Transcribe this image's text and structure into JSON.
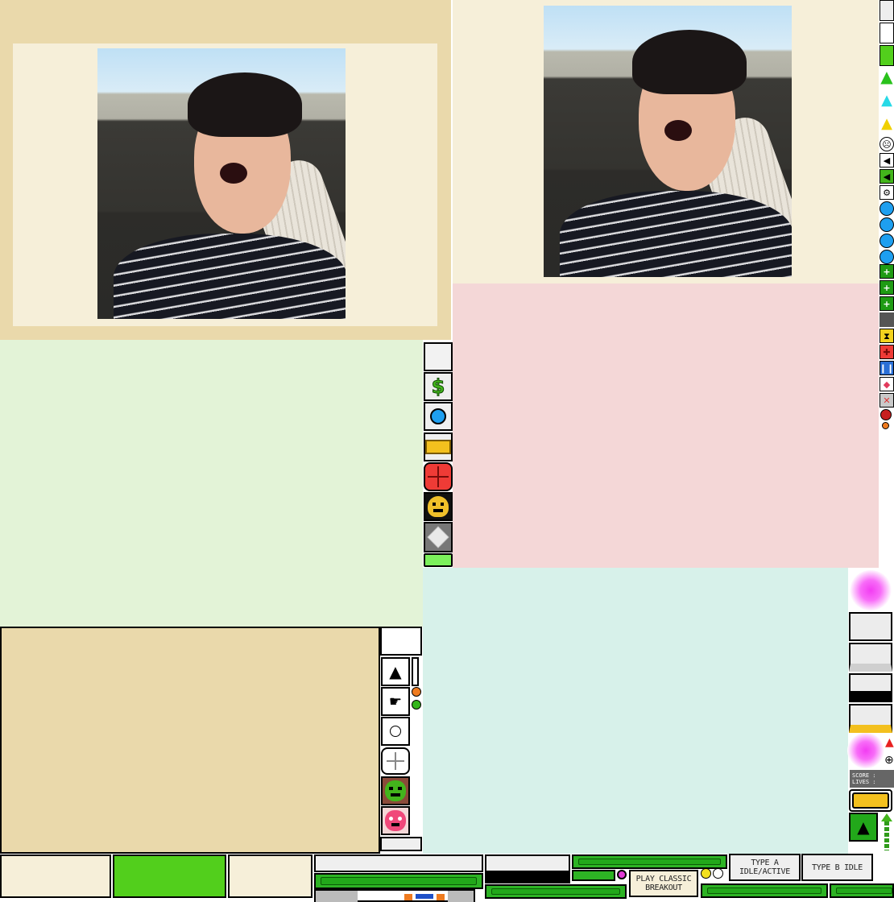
{
  "colors": {
    "panel_tan": "#ead9ab",
    "panel_cream": "#f6efd9",
    "panel_green": "#e3f3d7",
    "panel_pink": "#f4d7d7",
    "panel_mint": "#d7f1ea",
    "accent_green": "#52cf1c",
    "accent_yellow": "#f3c01e",
    "accent_red": "#ef3b36",
    "accent_magenta": "#f23cf2",
    "accent_blue": "#1e9ff0"
  },
  "photos": [
    {
      "name": "player-photo-left",
      "alt": "Photo of a young man yawning"
    },
    {
      "name": "player-photo-right",
      "alt": "Photo of a young man yawning"
    }
  ],
  "icons": {
    "right_column": [
      "blank-button",
      "blank-button",
      "green-button",
      "green-cursor-icon",
      "cyan-cursor-icon",
      "yellow-cursor-icon",
      "skull-icon",
      "speaker-icon",
      "speaker-active-icon",
      "gear-icon",
      "blue-ball-icon",
      "blue-ball-icon",
      "blue-ball-icon",
      "blue-ball-icon",
      "green-cross-icon",
      "green-cross-icon",
      "green-cross-icon",
      "hourglass-icon",
      "red-target-icon",
      "pause-icon",
      "shield-icon",
      "cross-box-icon",
      "red-bomb-icon",
      "orange-dot-icon"
    ],
    "middle_column": [
      "blank-button",
      "dollar-icon",
      "blue-ball-icon",
      "yellow-bar-icon",
      "red-crosshair-icon",
      "yellow-monster-icon",
      "cube-icon",
      "green-bar-icon"
    ],
    "lower_column": [
      "blank-button",
      "chevron-up-icon",
      "hand-pointer-icon",
      "white-ball-icon",
      "crosshair-icon",
      "green-monster-icon",
      "pink-monster-icon",
      "blank-button"
    ]
  },
  "score_label": "SCORE :",
  "lives_label": "LIVES :",
  "buttons": {
    "play_classic": "PLAY CLASSIC BREAKOUT",
    "type_a": "TYPE A IDLE/ACTIVE",
    "type_b": "TYPE B IDLE"
  },
  "currency_symbol": "$"
}
